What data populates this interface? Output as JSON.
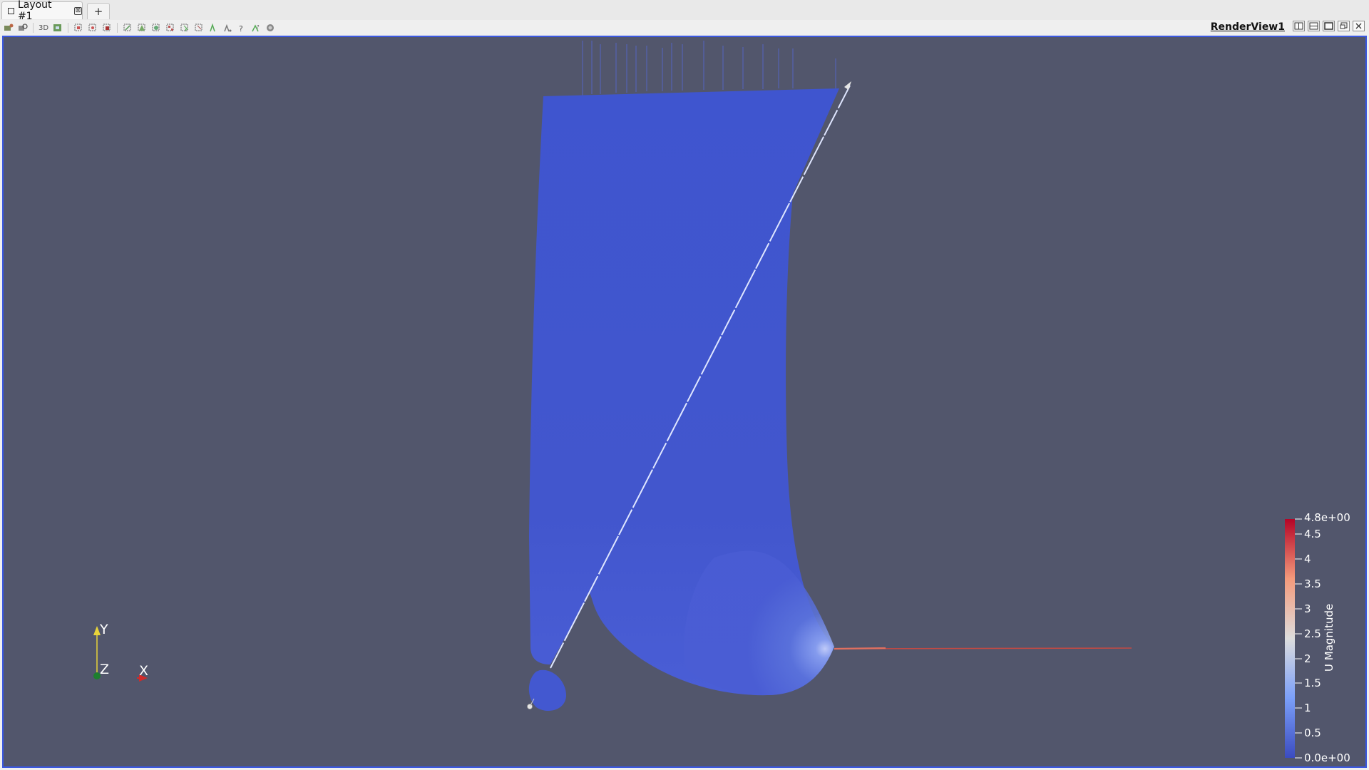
{
  "tabs": [
    {
      "label": "Layout #1",
      "close_glyph": "⊠"
    }
  ],
  "add_tab_label": "+",
  "toolbar": {
    "icons": [
      "reset-camera-icon",
      "zoom-to-data-icon",
      "3d-toggle",
      "camera-capture-icon",
      "select-cells-on-icon",
      "select-points-on-icon",
      "select-cells-frustum-icon",
      "select-points-frustum-icon",
      "select-polygon-cells-icon",
      "select-polygon-points-icon",
      "select-blocks-icon",
      "interactive-select-cells-icon",
      "interactive-select-points-icon",
      "hover-points-icon",
      "hover-cells-icon",
      "grow-selection-icon",
      "clear-selection-icon",
      "toggle-selection-display-icon"
    ],
    "label_3d": "3D"
  },
  "view": {
    "name": "RenderView1",
    "buttons": [
      "split-horizontal-icon",
      "split-vertical-icon",
      "maximize-icon",
      "restore-icon",
      "close-view-icon"
    ],
    "background_color": "#52566c",
    "border_color": "#3b58e0"
  },
  "orientation_axes": {
    "y": "Y",
    "z": "Z",
    "x": "X"
  },
  "color_legend": {
    "title": "U Magnitude",
    "colormap": "Cool to Warm",
    "range": [
      0,
      4.8
    ],
    "labels": [
      "4.8e+00",
      "4.5",
      "4",
      "3.5",
      "3",
      "2.5",
      "2",
      "1.5",
      "1",
      "0.5",
      "0.0e+00"
    ],
    "colors": {
      "low": "#3b4cc0",
      "mid": "#dddddd",
      "high": "#b40426"
    }
  }
}
